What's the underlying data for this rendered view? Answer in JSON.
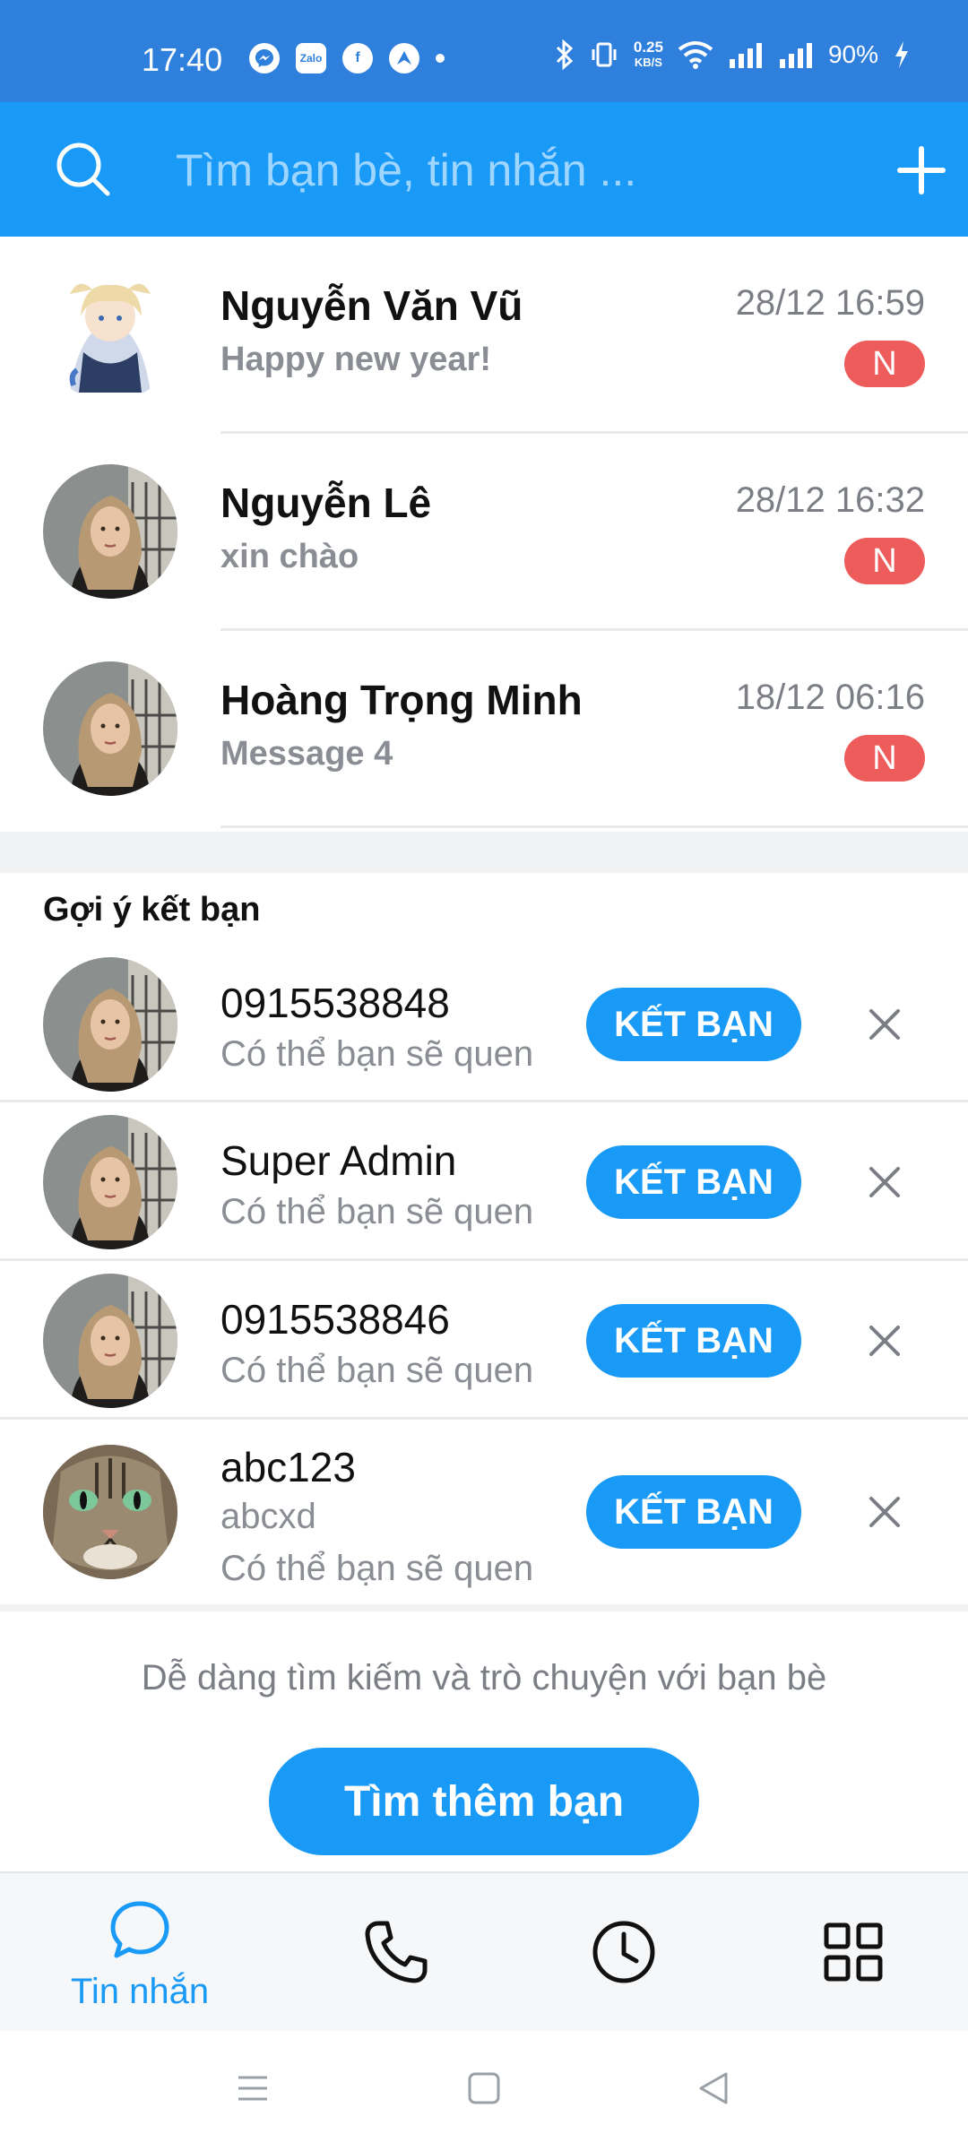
{
  "status_bar": {
    "time": "17:40",
    "apps": [
      "messenger-icon",
      "zalo-icon",
      "facebook-icon",
      "arrow-app-icon"
    ],
    "zalo_label": "Zalo",
    "speed_value": "0.25",
    "speed_unit": "KB/S",
    "battery": "90%"
  },
  "search": {
    "placeholder": "Tìm bạn bè, tin nhắn ..."
  },
  "conversations": [
    {
      "name": "Nguyễn Văn Vũ",
      "message": "Happy new year!",
      "time": "28/12 16:59",
      "badge": "N",
      "avatar": "anime-avatar"
    },
    {
      "name": "Nguyễn Lê",
      "message": "xin chào",
      "time": "28/12 16:32",
      "badge": "N",
      "avatar": "woman-avatar"
    },
    {
      "name": "Hoàng Trọng Minh",
      "message": "Message 4",
      "time": "18/12 06:16",
      "badge": "N",
      "avatar": "woman-avatar"
    }
  ],
  "suggestions": {
    "title": "Gợi ý kết bạn",
    "items": [
      {
        "name": "0915538848",
        "sub": "Có thể bạn sẽ quen",
        "button": "KẾT BẠN",
        "avatar": "woman-avatar"
      },
      {
        "name": "Super Admin",
        "sub": "Có thể bạn sẽ quen",
        "button": "KẾT BẠN",
        "avatar": "woman-avatar"
      },
      {
        "name": "0915538846",
        "sub": "Có thể bạn sẽ quen",
        "button": "KẾT BẠN",
        "avatar": "woman-avatar"
      },
      {
        "name": "abc123",
        "extra": "abcxd",
        "sub": "Có thể bạn sẽ quen",
        "button": "KẾT BẠN",
        "avatar": "cat-avatar"
      }
    ]
  },
  "hint": "Dễ dàng tìm kiếm và trò chuyện với bạn bè",
  "find_button": "Tìm thêm bạn",
  "bottom_nav": {
    "messages_label": "Tin nhắn",
    "items": [
      "chat-icon",
      "phone-icon",
      "clock-icon",
      "grid-icon"
    ],
    "active_color": "#1a9af7"
  },
  "colors": {
    "status_bar": "#2f7fdc",
    "header": "#1a9af7",
    "badge": "#ee5b5b",
    "accent": "#1a9af7"
  }
}
